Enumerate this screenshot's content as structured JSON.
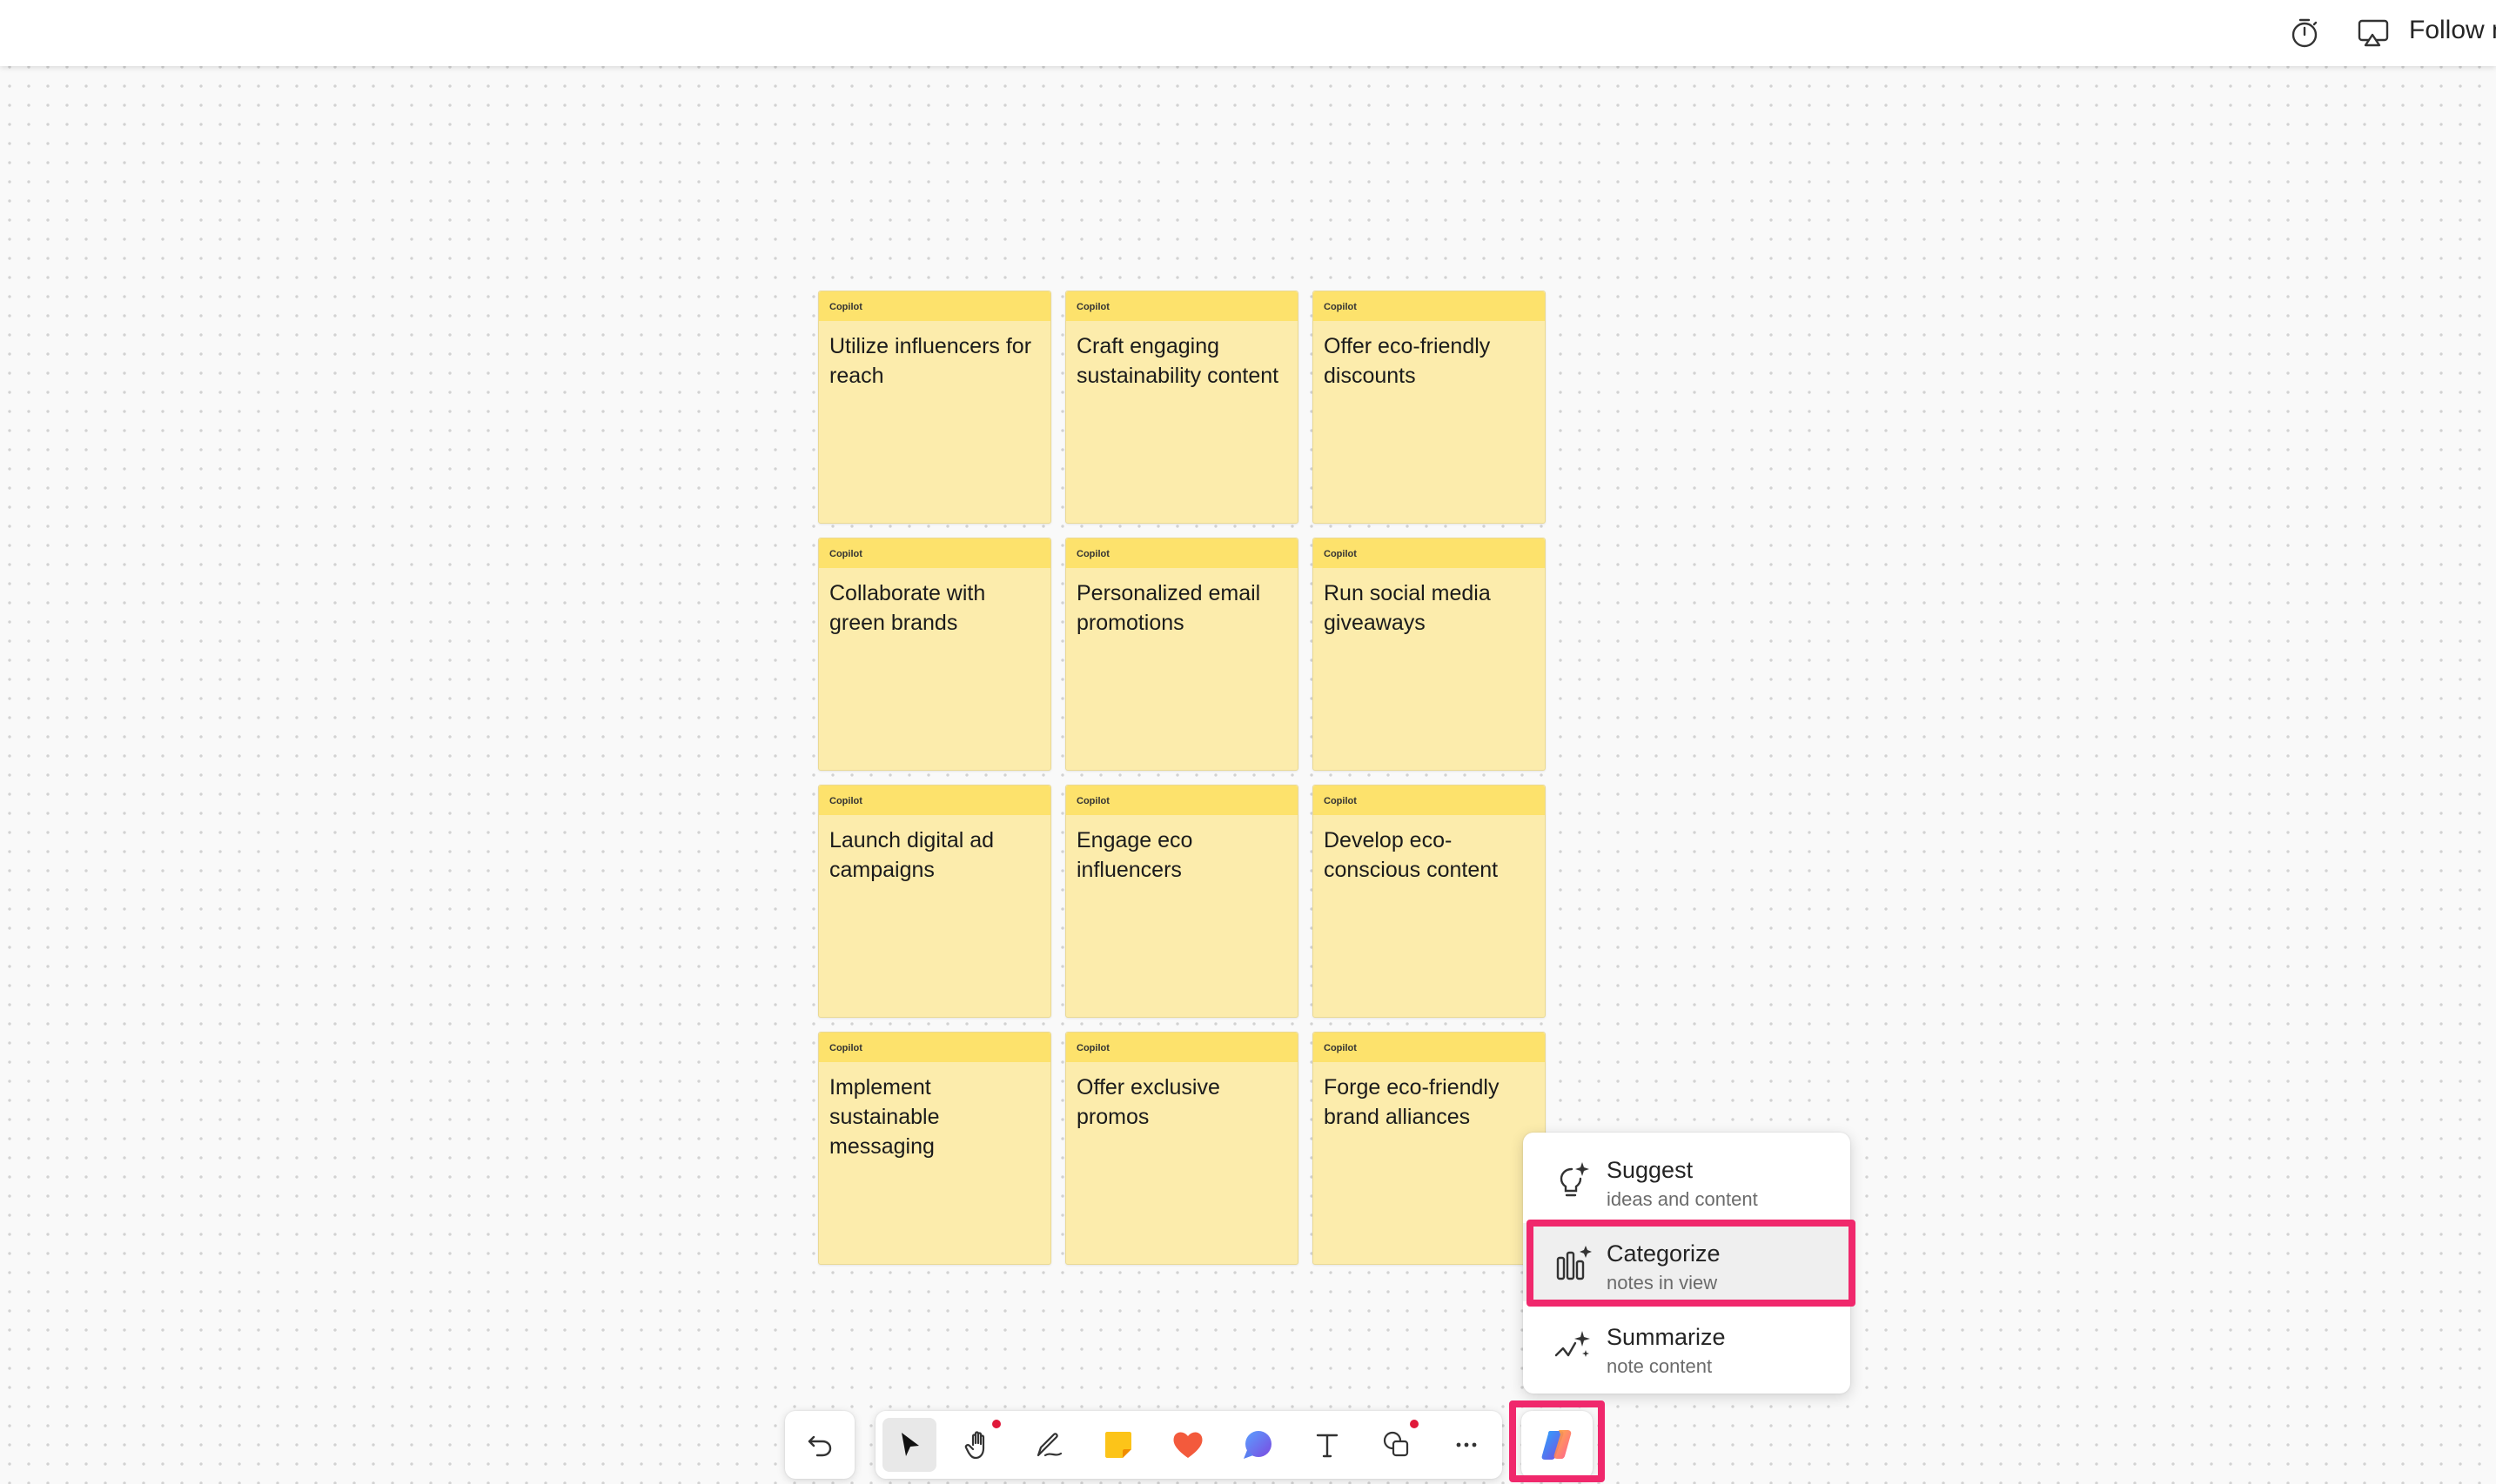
{
  "topbar": {
    "timer_icon": "timer-icon",
    "follow_icon": "cast-screen-icon",
    "follow_label": "Follow m"
  },
  "notes": [
    {
      "author": "Copilot",
      "text": "Utilize influencers for reach"
    },
    {
      "author": "Copilot",
      "text": "Craft engaging sustainability content"
    },
    {
      "author": "Copilot",
      "text": "Offer eco-friendly discounts"
    },
    {
      "author": "Copilot",
      "text": "Collaborate with green brands"
    },
    {
      "author": "Copilot",
      "text": "Personalized email promotions"
    },
    {
      "author": "Copilot",
      "text": "Run social media giveaways"
    },
    {
      "author": "Copilot",
      "text": "Launch digital ad campaigns"
    },
    {
      "author": "Copilot",
      "text": "Engage eco influencers"
    },
    {
      "author": "Copilot",
      "text": "Develop eco-conscious content"
    },
    {
      "author": "Copilot",
      "text": "Implement sustainable messaging"
    },
    {
      "author": "Copilot",
      "text": "Offer exclusive promos"
    },
    {
      "author": "Copilot",
      "text": "Forge eco-friendly brand alliances"
    }
  ],
  "copilot_menu": {
    "items": [
      {
        "label": "Suggest",
        "sub": "ideas and content",
        "icon": "lightbulb-sparkle-icon"
      },
      {
        "label": "Categorize",
        "sub": "notes in view",
        "icon": "categorize-sparkle-icon",
        "selected": true
      },
      {
        "label": "Summarize",
        "sub": "note content",
        "icon": "summarize-sparkle-icon"
      }
    ]
  },
  "toolbar": {
    "tools": [
      "undo-icon",
      "select-pointer-icon",
      "hand-pan-icon",
      "pen-icon",
      "sticky-note-icon",
      "reaction-heart-icon",
      "comment-bubble-icon",
      "text-tool-icon",
      "shapes-icon",
      "more-options-icon",
      "copilot-icon"
    ]
  },
  "colors": {
    "note_body": "#fcecac",
    "note_header": "#fde26c",
    "highlight": "#f0286c"
  }
}
